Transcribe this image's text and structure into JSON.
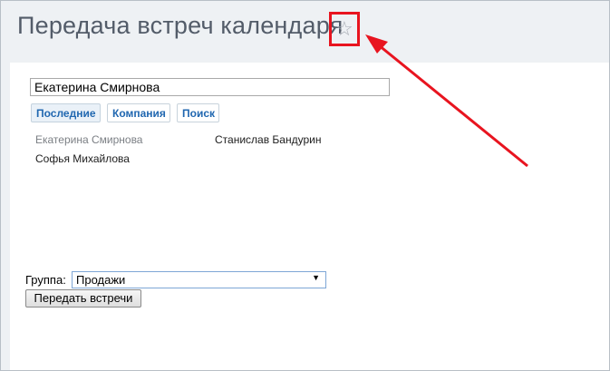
{
  "header": {
    "title": "Передача встреч календаря",
    "favorite_icon": "star-icon",
    "highlight_color": "#e8141f"
  },
  "selector": {
    "input_value": "Екатерина Смирнова",
    "tabs": [
      {
        "label": "Последние",
        "active": true
      },
      {
        "label": "Компания",
        "active": false
      },
      {
        "label": "Поиск",
        "active": false
      }
    ],
    "people": [
      {
        "name": "Екатерина Смирнова"
      },
      {
        "name": "Станислав Бандурин"
      },
      {
        "name": "Софья Михайлова"
      }
    ]
  },
  "group": {
    "label": "Группа:",
    "selected": "Продажи"
  },
  "actions": {
    "submit_label": "Передать встречи"
  },
  "colors": {
    "accent_link": "#2067b0",
    "title": "#535c69"
  }
}
